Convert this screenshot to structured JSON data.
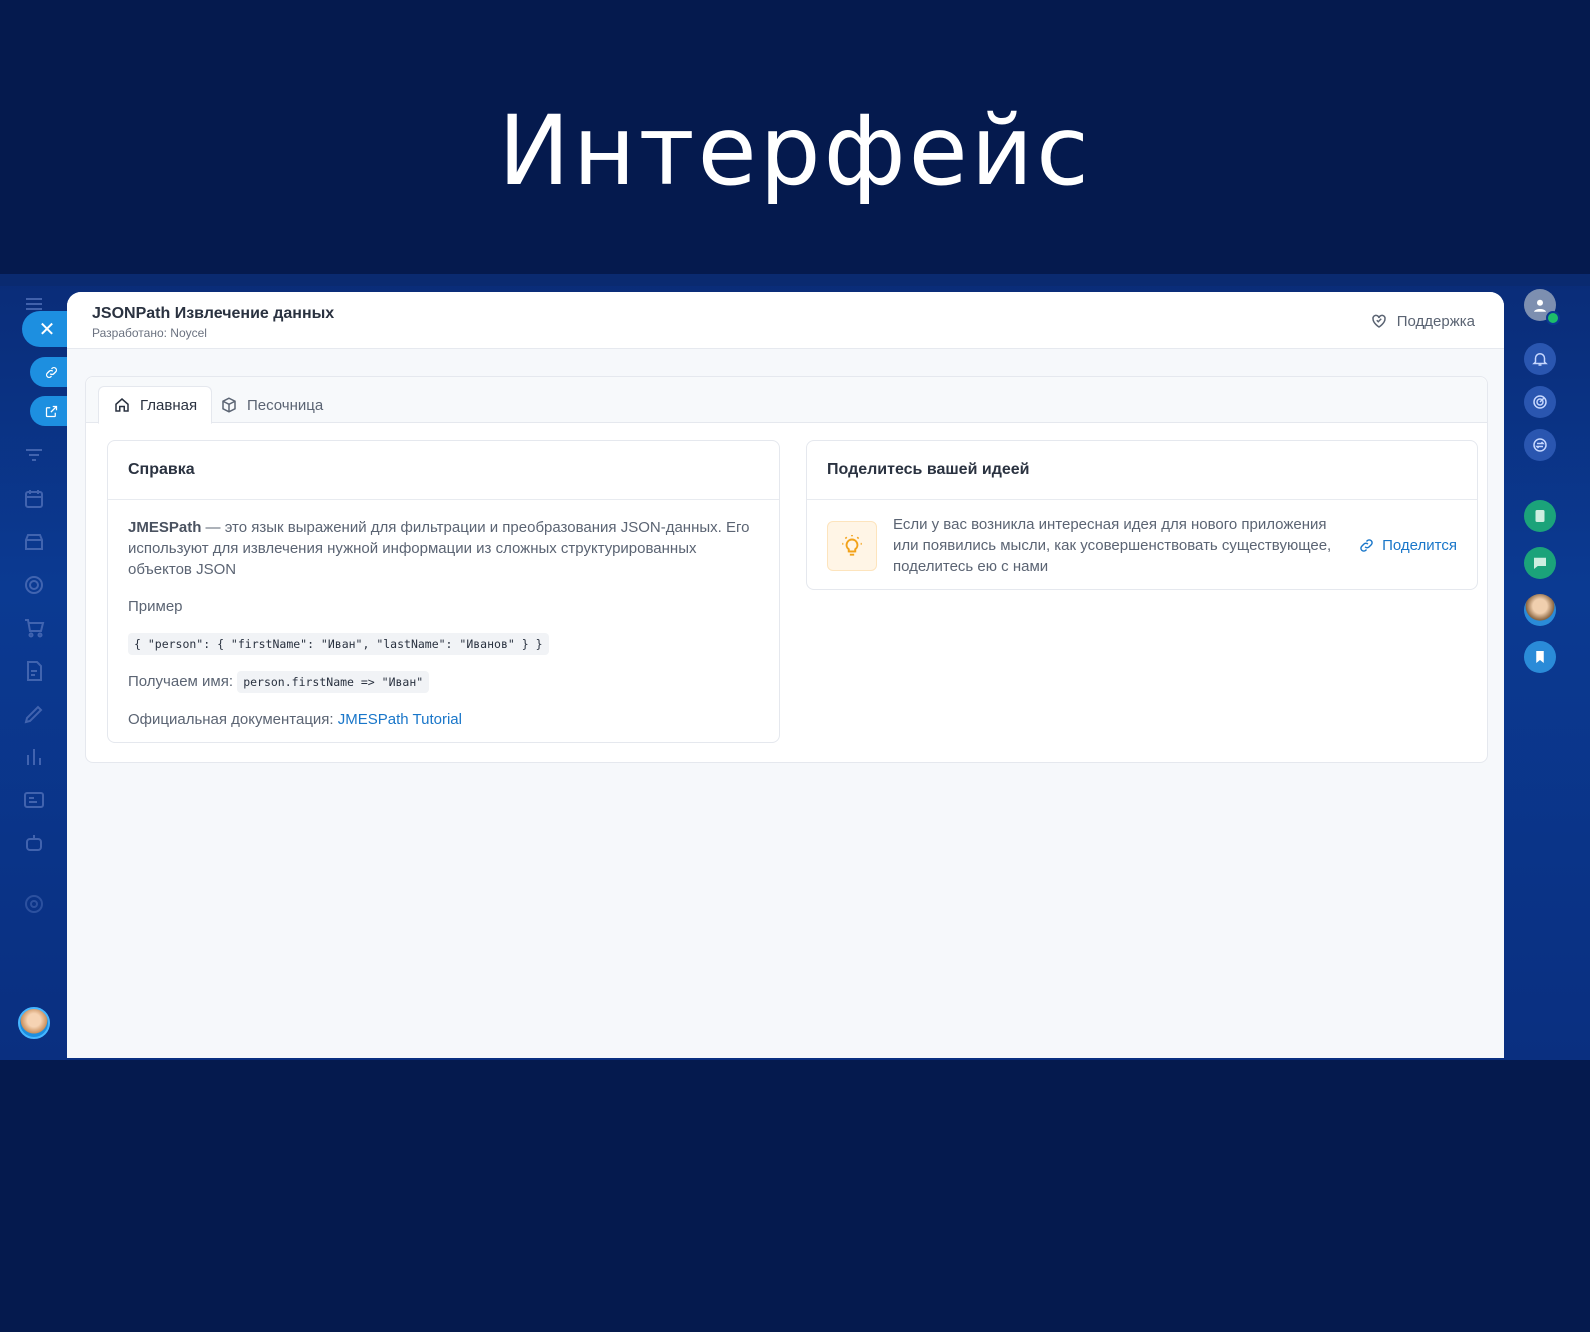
{
  "hero": {
    "title": "Интерфейс"
  },
  "window": {
    "title": "JSONPath Извлечение данных",
    "subtitle": "Разработано: Noycel",
    "support_label": "Поддержка"
  },
  "tabs": [
    {
      "label": "Главная",
      "icon": "home-icon",
      "active": true
    },
    {
      "label": "Песочница",
      "icon": "box-icon",
      "active": false
    }
  ],
  "help": {
    "heading": "Справка",
    "term": "JMESPath",
    "description": " — это язык выражений для фильтрации и преобразования JSON-данных. Его используют для извлечения нужной информации из сложных структурированных объектов JSON",
    "example_label": "Пример",
    "example_code": "{ \"person\": { \"firstName\": \"Иван\", \"lastName\": \"Иванов\" } }",
    "result_label": "Получаем имя:",
    "result_code": "person.firstName => \"Иван\"",
    "docs_label": "Официальная документация:",
    "docs_link": "JMESPath Tutorial"
  },
  "idea": {
    "heading": "Поделитесь вашей идеей",
    "text": "Если у вас возникла интересная идея для нового приложения или появились мысли, как усовершенствовать существующее, поделитесь ею с нами",
    "share_label": "Поделится",
    "icon": "lightbulb-icon"
  },
  "colors": {
    "background": "#051a4e",
    "accent": "#1d8fe0",
    "link": "#1976c9"
  }
}
